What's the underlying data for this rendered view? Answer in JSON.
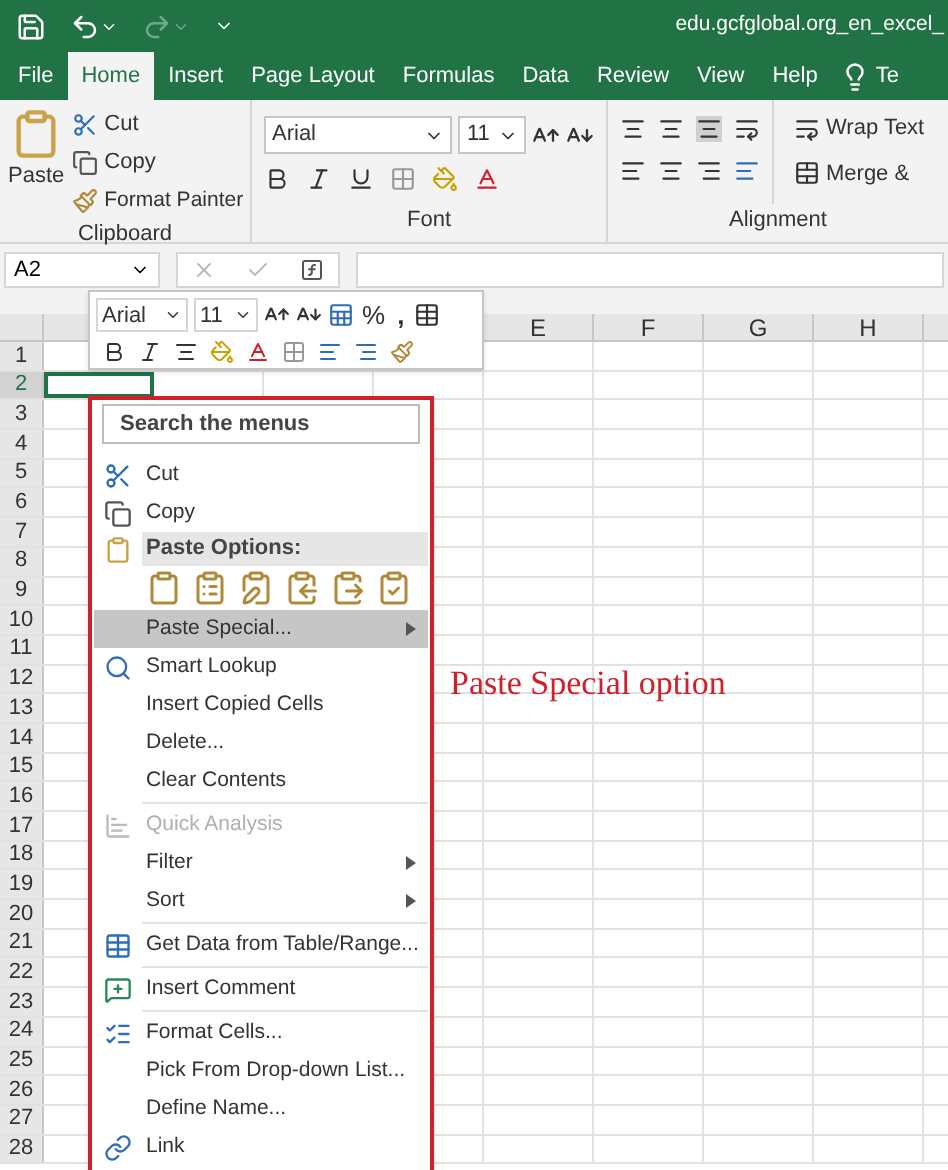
{
  "title_bar": {
    "document_title": "edu.gcfglobal.org_en_excel_"
  },
  "ribbon_tabs": [
    {
      "label": "File",
      "selected": false
    },
    {
      "label": "Home",
      "selected": true
    },
    {
      "label": "Insert",
      "selected": false
    },
    {
      "label": "Page Layout",
      "selected": false
    },
    {
      "label": "Formulas",
      "selected": false
    },
    {
      "label": "Data",
      "selected": false
    },
    {
      "label": "Review",
      "selected": false
    },
    {
      "label": "View",
      "selected": false
    },
    {
      "label": "Help",
      "selected": false
    }
  ],
  "tell_me": {
    "label": "Te"
  },
  "clipboard": {
    "paste": "Paste",
    "cut": "Cut",
    "copy": "Copy",
    "format_painter": "Format Painter",
    "group_label": "Clipboard"
  },
  "font": {
    "font_name": "Arial",
    "font_size": "11",
    "group_label": "Font"
  },
  "alignment": {
    "wrap_text": "Wrap Text",
    "merge": "Merge & ",
    "group_label": "Alignment"
  },
  "formula_bar": {
    "name_box": "A2"
  },
  "mini_toolbar": {
    "font_name": "Arial",
    "font_size": "11",
    "percent": "%",
    "comma": ","
  },
  "grid": {
    "columns": [
      "E",
      "F",
      "G",
      "H"
    ],
    "rows": [
      {
        "label": "1",
        "selected": false
      },
      {
        "label": "2",
        "selected": true
      },
      {
        "label": "3",
        "selected": false
      },
      {
        "label": "4",
        "selected": false
      },
      {
        "label": "5",
        "selected": false
      },
      {
        "label": "6",
        "selected": false
      },
      {
        "label": "7",
        "selected": false
      },
      {
        "label": "8",
        "selected": false
      },
      {
        "label": "9",
        "selected": false
      },
      {
        "label": "10",
        "selected": false
      },
      {
        "label": "11",
        "selected": false
      },
      {
        "label": "12",
        "selected": false
      },
      {
        "label": "13",
        "selected": false
      },
      {
        "label": "14",
        "selected": false
      },
      {
        "label": "15",
        "selected": false
      },
      {
        "label": "16",
        "selected": false
      },
      {
        "label": "17",
        "selected": false
      },
      {
        "label": "18",
        "selected": false
      },
      {
        "label": "19",
        "selected": false
      },
      {
        "label": "20",
        "selected": false
      },
      {
        "label": "21",
        "selected": false
      },
      {
        "label": "22",
        "selected": false
      },
      {
        "label": "23",
        "selected": false
      },
      {
        "label": "24",
        "selected": false
      },
      {
        "label": "25",
        "selected": false
      },
      {
        "label": "26",
        "selected": false
      },
      {
        "label": "27",
        "selected": false
      },
      {
        "label": "28",
        "selected": false
      }
    ]
  },
  "context_menu": {
    "search": {
      "placeholder": "Search the menus"
    },
    "items": [
      {
        "kind": "item",
        "label": "Cut",
        "disabled": false,
        "selected": false,
        "submenu": false
      },
      {
        "kind": "item",
        "label": "Copy",
        "disabled": false,
        "selected": false,
        "submenu": false
      },
      {
        "kind": "header",
        "label": "Paste Options:"
      },
      {
        "kind": "paste_options"
      },
      {
        "kind": "item",
        "label": "Paste Special...",
        "disabled": false,
        "selected": true,
        "submenu": true
      },
      {
        "kind": "item",
        "label": "Smart Lookup",
        "disabled": false,
        "selected": false,
        "submenu": false
      },
      {
        "kind": "item",
        "label": "Insert Copied Cells",
        "disabled": false,
        "selected": false,
        "submenu": false
      },
      {
        "kind": "item",
        "label": "Delete...",
        "disabled": false,
        "selected": false,
        "submenu": false
      },
      {
        "kind": "item",
        "label": "Clear Contents",
        "disabled": false,
        "selected": false,
        "submenu": false
      },
      {
        "kind": "separator"
      },
      {
        "kind": "item",
        "label": "Quick Analysis",
        "disabled": true,
        "selected": false,
        "submenu": false
      },
      {
        "kind": "item",
        "label": "Filter",
        "disabled": false,
        "selected": false,
        "submenu": true
      },
      {
        "kind": "item",
        "label": "Sort",
        "disabled": false,
        "selected": false,
        "submenu": true
      },
      {
        "kind": "separator"
      },
      {
        "kind": "item",
        "label": "Get Data from Table/Range...",
        "disabled": false,
        "selected": false,
        "submenu": false
      },
      {
        "kind": "separator"
      },
      {
        "kind": "item",
        "label": "Insert Comment",
        "disabled": false,
        "selected": false,
        "submenu": false
      },
      {
        "kind": "separator"
      },
      {
        "kind": "item",
        "label": "Format Cells...",
        "disabled": false,
        "selected": false,
        "submenu": false
      },
      {
        "kind": "item",
        "label": "Pick From Drop-down List...",
        "disabled": false,
        "selected": false,
        "submenu": false
      },
      {
        "kind": "item",
        "label": "Define Name...",
        "disabled": false,
        "selected": false,
        "submenu": false
      },
      {
        "kind": "item",
        "label": "Link",
        "disabled": false,
        "selected": false,
        "submenu": false
      }
    ]
  },
  "annotation": {
    "text": "Paste Special option"
  }
}
